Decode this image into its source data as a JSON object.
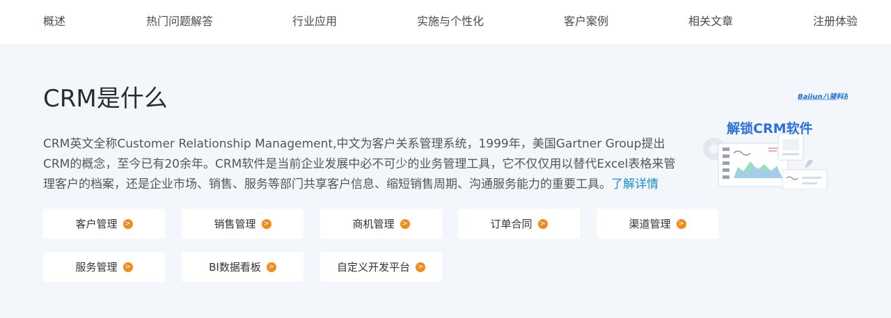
{
  "nav": {
    "items": [
      "概述",
      "热门问题解答",
      "行业应用",
      "实施与个性化",
      "客户案例",
      "相关文章",
      "注册体验"
    ]
  },
  "main": {
    "title": "CRM是什么",
    "description": "CRM英文全称Customer Relationship Management,中文为客户关系管理系统，1999年，美国Gartner Group提出CRM的概念，至今已有20余年。CRM软件是当前企业发展中必不可少的业务管理工具，它不仅仅用以替代Excel表格来管理客户的档案，还是企业市场、销售、服务等部门共享客户信息、缩短销售周期、沟通服务能力的重要工具。",
    "more_link": "了解详情"
  },
  "banner": {
    "logo": "Baijun八骏科技",
    "title": "解锁CRM软件"
  },
  "features": [
    "客户管理",
    "销售管理",
    "商机管理",
    "订单合同",
    "渠道管理",
    "服务管理",
    "BI数据看板",
    "自定义开发平台"
  ],
  "icons": {
    "arrow": "arrow-right-circle-icon"
  },
  "colors": {
    "accent": "#f18b1a",
    "link": "#1a8fd8",
    "banner_title": "#2c6fe0",
    "background": "#f3f6fa"
  }
}
